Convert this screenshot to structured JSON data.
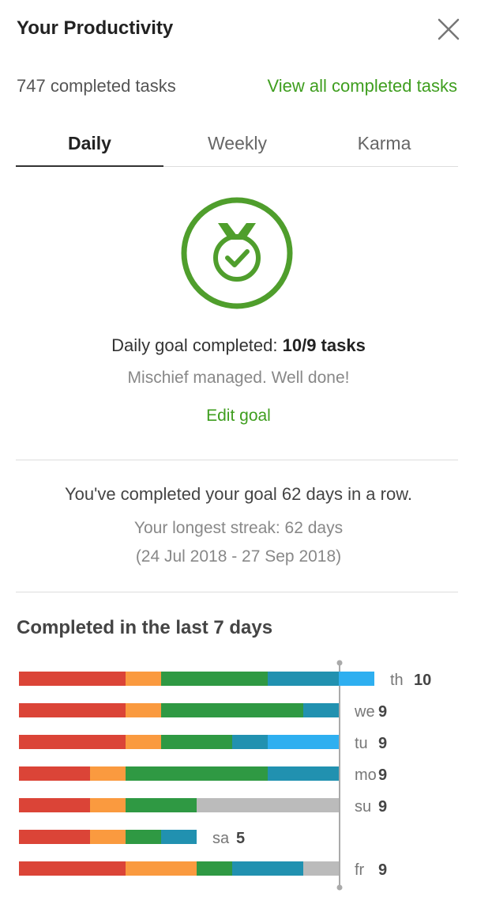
{
  "header": {
    "title": "Your Productivity"
  },
  "summary": {
    "completed_count": "747 completed tasks",
    "view_all": "View all completed tasks"
  },
  "tabs": [
    {
      "label": "Daily",
      "active": true
    },
    {
      "label": "Weekly",
      "active": false
    },
    {
      "label": "Karma",
      "active": false
    }
  ],
  "goal": {
    "line_prefix": "Daily goal completed: ",
    "line_value": "10/9 tasks",
    "message": "Mischief managed. Well done!",
    "edit_label": "Edit goal"
  },
  "streak": {
    "current": "You've completed your goal 62 days in a row.",
    "longest": "Your longest streak: 62 days",
    "range": "(24 Jul 2018 - 27 Sep 2018)"
  },
  "chart_title": "Completed in the last 7 days",
  "colors": {
    "accent": "#3f9e1f",
    "red": "#db4437",
    "orange": "#fa9a3f",
    "green": "#2f9943",
    "teal": "#2191b0",
    "blue": "#2eaff0",
    "gray": "#bbbbbb"
  },
  "chart_data": {
    "type": "bar",
    "orientation": "horizontal",
    "stacked": true,
    "goal_line": 9,
    "categories": [
      "th",
      "we",
      "tu",
      "mo",
      "su",
      "sa",
      "fr"
    ],
    "totals": [
      10,
      9,
      9,
      9,
      9,
      5,
      9
    ],
    "segments": [
      [
        {
          "color": "red",
          "value": 3
        },
        {
          "color": "orange",
          "value": 1
        },
        {
          "color": "green",
          "value": 3
        },
        {
          "color": "teal",
          "value": 2
        },
        {
          "color": "blue",
          "value": 1
        }
      ],
      [
        {
          "color": "red",
          "value": 3
        },
        {
          "color": "orange",
          "value": 1
        },
        {
          "color": "green",
          "value": 4
        },
        {
          "color": "teal",
          "value": 1
        }
      ],
      [
        {
          "color": "red",
          "value": 3
        },
        {
          "color": "orange",
          "value": 1
        },
        {
          "color": "green",
          "value": 2
        },
        {
          "color": "teal",
          "value": 1
        },
        {
          "color": "blue",
          "value": 2
        }
      ],
      [
        {
          "color": "red",
          "value": 2
        },
        {
          "color": "orange",
          "value": 1
        },
        {
          "color": "green",
          "value": 4
        },
        {
          "color": "teal",
          "value": 2
        }
      ],
      [
        {
          "color": "red",
          "value": 2
        },
        {
          "color": "orange",
          "value": 1
        },
        {
          "color": "green",
          "value": 2
        },
        {
          "color": "gray",
          "value": 4
        }
      ],
      [
        {
          "color": "red",
          "value": 2
        },
        {
          "color": "orange",
          "value": 1
        },
        {
          "color": "green",
          "value": 1
        },
        {
          "color": "teal",
          "value": 1
        }
      ],
      [
        {
          "color": "red",
          "value": 3
        },
        {
          "color": "orange",
          "value": 2
        },
        {
          "color": "green",
          "value": 1
        },
        {
          "color": "teal",
          "value": 2
        },
        {
          "color": "gray",
          "value": 1
        }
      ]
    ]
  }
}
